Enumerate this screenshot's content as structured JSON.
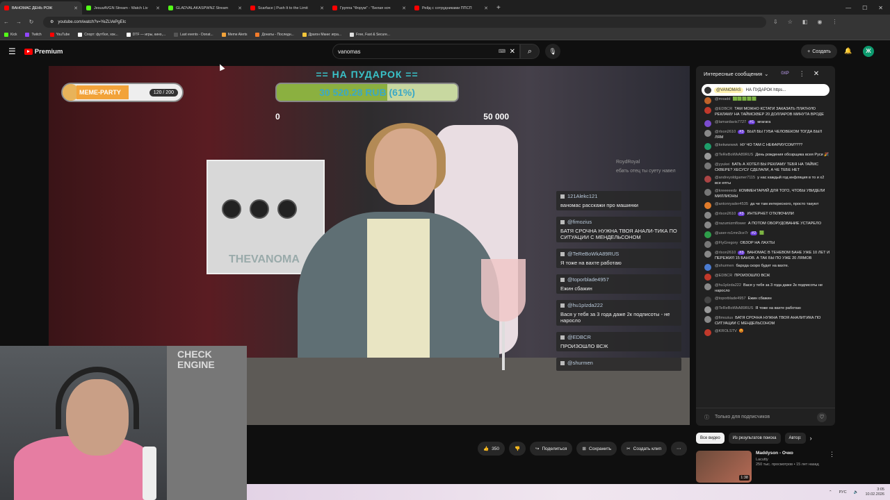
{
  "browser": {
    "tabs": [
      {
        "title": "ВАНОМАС ДЕНЬ РОЖ",
        "color": "#ff0000"
      },
      {
        "title": "JesusAVGN Stream - Watch Liv",
        "color": "#53fc18"
      },
      {
        "title": "GLADVALAKASPWNZ Stream",
        "color": "#53fc18"
      },
      {
        "title": "Scarface | Push It to the Limit",
        "color": "#ff0000"
      },
      {
        "title": "Группа \"Форум\" - \"Белая ноч",
        "color": "#ff0000"
      },
      {
        "title": "Рейд с сотрудниками ППСП",
        "color": "#ff0000"
      }
    ],
    "url": "youtube.com/watch?v=YeZLVePgEIc",
    "bookmarks": [
      {
        "label": "Kick",
        "color": "#53fc18"
      },
      {
        "label": "Twitch",
        "color": "#9146ff"
      },
      {
        "label": "YouTube",
        "color": "#ff0000"
      },
      {
        "label": "Спорт: футбол, хок...",
        "color": "#ffffff"
      },
      {
        "label": "DTF — игры, кино,...",
        "color": "#ffffff"
      },
      {
        "label": "Last events - Donat...",
        "color": "#555555"
      },
      {
        "label": "Meme Alerts",
        "color": "#f2a33a"
      },
      {
        "label": "Донаты - Последн...",
        "color": "#f27b2a"
      },
      {
        "label": "Драгон Мани: игра...",
        "color": "#f2c53a"
      },
      {
        "label": "Free, Fast & Secure...",
        "color": "#dddddd"
      }
    ]
  },
  "youtube": {
    "logo_text": "Premium",
    "search_value": "vanomas",
    "create_label": "Создать",
    "avatar_letter": "Ж"
  },
  "overlay": {
    "donation_title": "== НА ПУДАРОК ==",
    "donation_amount": "30 520.28 RUB (61%)",
    "donation_progress": 0.61,
    "donation_min": "0",
    "donation_max": "50 000",
    "meme_party_label": "MEME-PARTY",
    "meme_party_count": "120 / 200",
    "pc_brand": "THEVANOMA",
    "ghost_user": "RoydRoyal",
    "ghost_text": "ебать отец ты суету навел",
    "chat": [
      {
        "user": "121Alekc121",
        "text": "ваномас расскажи про машинки"
      },
      {
        "user": "@fimozius",
        "text": "БАТЯ СРОЧНА НУЖНА ТВОЯ АНАЛИ-ТИКА ПО СИТУАЦИИ С МЕНДЕЛЬСОНОМ"
      },
      {
        "user": "@TeReBoWkA89RUS",
        "text": "Я тоже на вахте работаю"
      },
      {
        "user": "@toporblade4957",
        "text": "Ежин сбажин"
      },
      {
        "user": "@hu1pIzda222",
        "text": "Вася у тебя за 3 года даже 2к подписоты - не наросло"
      },
      {
        "user": "@EDBCR",
        "text": "ПРОИЗОШЛО ВСЖ"
      },
      {
        "user": "@shurmen",
        "text": ""
      }
    ]
  },
  "webcam": {
    "sign": "CHECK ENGINE"
  },
  "live_chat": {
    "title": "Интересные сообщения",
    "xp_label": "0XP",
    "pinned_user": "@VANOMAS",
    "pinned_text": "НА ПУДАРОК https...",
    "messages": [
      {
        "user": "@mxadd",
        "badge": "",
        "text": "🟩🟩🟩🟩🟩",
        "color": "#c0632a"
      },
      {
        "user": "@EDBCR",
        "badge": "",
        "text": "ТАМ МОЖНО КСТАТИ ЗАКАЗАТЬ ПЛАТНУЮ РЕКЛАМУ НА ТАЙМСКВЕР 20 ДОЛЛАРОВ МИНУТА ВРОДЕ",
        "color": "#c0392b"
      },
      {
        "user": "@lamardavis7727",
        "badge": "#1",
        "text": "мгагага",
        "color": "#7b4ccf"
      },
      {
        "user": "@rlxon2610",
        "badge": "#3",
        "text": "БЫЛ БЫ ГУБА ЧЕЛОВЕКОМ ТОГДА БЫЛ ЛЯМ",
        "color": "#888888"
      },
      {
        "user": "@kekwwwwk",
        "badge": "",
        "text": "НУ ЧО ТАМ С НЕФАРИУСОМ????",
        "color": "#1e9e6a"
      },
      {
        "user": "@TeReBoWkA89RUS",
        "badge": "",
        "text": "День рождения обозрщика всея Руси 🎉",
        "color": "#999999"
      },
      {
        "user": "@yyukei",
        "badge": "",
        "text": "БАТЬ А ХОТЕЛ БЫ РЕКЛАМУ ТЕБЯ НА ТАЙМС СКВЕРЕ? ХЕСУСУ СДЕЛАЛИ, А ЧЕ ТЕБЕ НЕТ",
        "color": "#777777"
      },
      {
        "user": "@andreyoldgamer7115",
        "badge": "",
        "text": "у нас каждый год инфляция в то и x2 все епты",
        "color": "#aa4444"
      },
      {
        "user": "@kreeeeedz",
        "badge": "",
        "text": "КОММЕНТАРИЙ ДЛЯ ТОГО, ЧТОБЫ УВИДЕЛИ МИЛЛИОНЫ",
        "color": "#777777"
      },
      {
        "user": "@antonryader4535",
        "badge": "",
        "text": "да че там интересного, просто такуют",
        "color": "#e07b2a"
      },
      {
        "user": "@rlxon2610",
        "badge": "#3",
        "text": "ИНТЕРНЕТ ОТКЛЮЧИЛИ",
        "color": "#888888"
      },
      {
        "user": "@razumizmflower",
        "badge": "",
        "text": "А ПОТОМ ОБОРУДОВАНИЕ УСТАРЕЛО",
        "color": "#888888"
      },
      {
        "user": "@user-rs1mn3ce7r",
        "badge": "#2",
        "text": "🟩",
        "color": "#2e9e4a"
      },
      {
        "user": "@FlyGregory",
        "badge": "",
        "text": "ОБЗОР НА ЛАХТЫ",
        "color": "#777777"
      },
      {
        "user": "@rlxon2610",
        "badge": "#3",
        "text": "ВАНОМАС В ТЕНЕВОМ БАНЕ УЖЕ 10 ЛЕТ И ПЕРЕЖИЛ 15 БАНОВ. А ТАК БЫ ПО УЖЕ 20 ЛЯМОВ",
        "color": "#888888"
      },
      {
        "user": "@shurmen",
        "badge": "",
        "text": "бархда скоро будет на вахте.",
        "color": "#4a7bd0"
      },
      {
        "user": "@EDBCR",
        "badge": "",
        "text": "ПРОИЗОШЛО ВСЖ",
        "color": "#c0392b"
      },
      {
        "user": "@hu1pIzda222",
        "badge": "",
        "text": "Вася у тебя за 3 года даже 2к подписоты не наросло",
        "color": "#888888"
      },
      {
        "user": "@toporblade4957",
        "badge": "",
        "text": "Ежин сбажин",
        "color": "#444444"
      },
      {
        "user": "@TeReBoWkA89RUS",
        "badge": "",
        "text": "Я тоже на вахте работаю",
        "color": "#999999"
      },
      {
        "user": "@fimozius",
        "badge": "",
        "text": "БАТЯ СРОЧНА НУЖНА ТВОЯ АНАЛИТИКА ПО СИТУАЦИИ С МЕНДЕЛЬСОНОМ",
        "color": "#888888"
      },
      {
        "user": "@KROLSTV",
        "badge": "",
        "text": "😡",
        "color": "#c0392b"
      }
    ],
    "footer_text": "Только для подписчиков"
  },
  "actions": {
    "likes": "350",
    "share": "Поделиться",
    "save": "Сохранить",
    "clip": "Создать клип"
  },
  "filters": [
    "Все видео",
    "Из результатов поиска",
    "Автор: "
  ],
  "recommendation": {
    "title": "Maddyson - Очко",
    "channel": "Lacutty",
    "meta": "250 тыс. просмотров • 15 лет назад",
    "duration": "1:38"
  },
  "taskbar": {
    "lang": "РУС",
    "time": "3:05",
    "date": "10.02.2026"
  }
}
